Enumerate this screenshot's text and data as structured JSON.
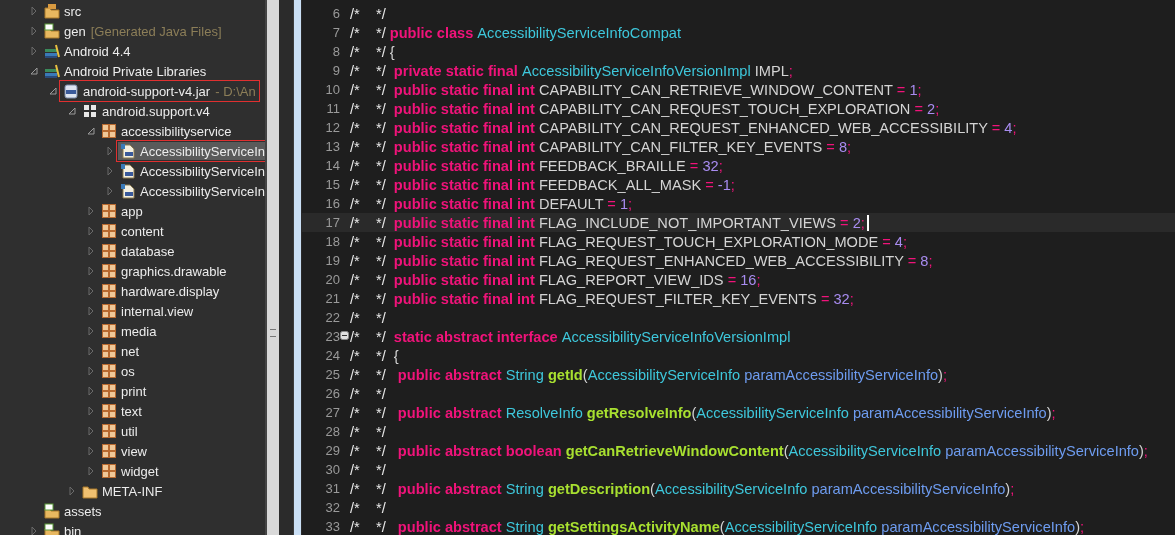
{
  "package_explorer": {
    "items": [
      {
        "label": "src",
        "kind": "source-folder",
        "expanded": false,
        "selected": false,
        "highlighted": false
      },
      {
        "label": "gen",
        "suffix": "[Generated Java Files]",
        "kind": "gen-folder",
        "expanded": false,
        "selected": false,
        "highlighted": false
      },
      {
        "label": "Android 4.4",
        "kind": "library",
        "expanded": false,
        "selected": false,
        "highlighted": false
      },
      {
        "label": "Android Private Libraries",
        "kind": "library",
        "expanded": true,
        "selected": false,
        "highlighted": false,
        "children": [
          {
            "label": "android-support-v4.jar",
            "suffix": "- D:\\An",
            "kind": "jar",
            "expanded": true,
            "selected": false,
            "highlighted": true,
            "children": [
              {
                "label": "android.support.v4",
                "kind": "package-root",
                "expanded": true,
                "selected": false,
                "highlighted": false,
                "children": [
                  {
                    "label": "accessibilityservice",
                    "kind": "package",
                    "expanded": true,
                    "selected": false,
                    "highlighted": false,
                    "children": [
                      {
                        "label": "AccessibilityServiceIn",
                        "kind": "class-file",
                        "expanded": false,
                        "selected": true,
                        "highlighted": true
                      },
                      {
                        "label": "AccessibilityServiceIn",
                        "kind": "class-file",
                        "expanded": false,
                        "selected": false,
                        "highlighted": false
                      },
                      {
                        "label": "AccessibilityServiceIn",
                        "kind": "class-file",
                        "expanded": false,
                        "selected": false,
                        "highlighted": false
                      }
                    ]
                  },
                  {
                    "label": "app",
                    "kind": "package",
                    "expanded": false,
                    "selected": false,
                    "highlighted": false
                  },
                  {
                    "label": "content",
                    "kind": "package",
                    "expanded": false,
                    "selected": false,
                    "highlighted": false
                  },
                  {
                    "label": "database",
                    "kind": "package",
                    "expanded": false,
                    "selected": false,
                    "highlighted": false
                  },
                  {
                    "label": "graphics.drawable",
                    "kind": "package",
                    "expanded": false,
                    "selected": false,
                    "highlighted": false
                  },
                  {
                    "label": "hardware.display",
                    "kind": "package",
                    "expanded": false,
                    "selected": false,
                    "highlighted": false
                  },
                  {
                    "label": "internal.view",
                    "kind": "package",
                    "expanded": false,
                    "selected": false,
                    "highlighted": false
                  },
                  {
                    "label": "media",
                    "kind": "package",
                    "expanded": false,
                    "selected": false,
                    "highlighted": false
                  },
                  {
                    "label": "net",
                    "kind": "package",
                    "expanded": false,
                    "selected": false,
                    "highlighted": false
                  },
                  {
                    "label": "os",
                    "kind": "package",
                    "expanded": false,
                    "selected": false,
                    "highlighted": false
                  },
                  {
                    "label": "print",
                    "kind": "package",
                    "expanded": false,
                    "selected": false,
                    "highlighted": false
                  },
                  {
                    "label": "text",
                    "kind": "package",
                    "expanded": false,
                    "selected": false,
                    "highlighted": false
                  },
                  {
                    "label": "util",
                    "kind": "package",
                    "expanded": false,
                    "selected": false,
                    "highlighted": false
                  },
                  {
                    "label": "view",
                    "kind": "package",
                    "expanded": false,
                    "selected": false,
                    "highlighted": false
                  },
                  {
                    "label": "widget",
                    "kind": "package",
                    "expanded": false,
                    "selected": false,
                    "highlighted": false
                  }
                ]
              },
              {
                "label": "META-INF",
                "kind": "folder",
                "expanded": false,
                "selected": false,
                "highlighted": false
              }
            ]
          }
        ]
      },
      {
        "label": "assets",
        "kind": "gen-folder",
        "selected": false,
        "highlighted": false
      },
      {
        "label": "bin",
        "kind": "gen-folder",
        "expanded": false,
        "selected": false,
        "highlighted": false
      }
    ]
  },
  "editor": {
    "lines": [
      {
        "number": "6",
        "current": false,
        "tokens": [
          {
            "kind": "comment",
            "text": "/*    */"
          }
        ]
      },
      {
        "number": "7",
        "current": false,
        "tokens": [
          {
            "kind": "comment",
            "text": "/*    */ "
          },
          {
            "kind": "keyword",
            "text": "public class "
          },
          {
            "kind": "type",
            "text": "AccessibilityServiceInfoCompat"
          }
        ]
      },
      {
        "number": "8",
        "current": false,
        "tokens": [
          {
            "kind": "comment",
            "text": "/*    */ "
          },
          {
            "kind": "plain",
            "text": "{"
          }
        ]
      },
      {
        "number": "9",
        "current": false,
        "tokens": [
          {
            "kind": "comment",
            "text": "/*    */  "
          },
          {
            "kind": "keyword",
            "text": "private static final "
          },
          {
            "kind": "type",
            "text": "AccessibilityServiceInfoVersionImpl "
          },
          {
            "kind": "plain",
            "text": "IMPL"
          },
          {
            "kind": "operator",
            "text": ";"
          }
        ]
      },
      {
        "number": "10",
        "current": false,
        "tokens": [
          {
            "kind": "comment",
            "text": "/*    */  "
          },
          {
            "kind": "keyword",
            "text": "public static final int "
          },
          {
            "kind": "plain",
            "text": "CAPABILITY_CAN_RETRIEVE_WINDOW_CONTENT "
          },
          {
            "kind": "operator",
            "text": "= "
          },
          {
            "kind": "number",
            "text": "1"
          },
          {
            "kind": "operator",
            "text": ";"
          }
        ]
      },
      {
        "number": "11",
        "current": false,
        "tokens": [
          {
            "kind": "comment",
            "text": "/*    */  "
          },
          {
            "kind": "keyword",
            "text": "public static final int "
          },
          {
            "kind": "plain",
            "text": "CAPABILITY_CAN_REQUEST_TOUCH_EXPLORATION "
          },
          {
            "kind": "operator",
            "text": "= "
          },
          {
            "kind": "number",
            "text": "2"
          },
          {
            "kind": "operator",
            "text": ";"
          }
        ]
      },
      {
        "number": "12",
        "current": false,
        "tokens": [
          {
            "kind": "comment",
            "text": "/*    */  "
          },
          {
            "kind": "keyword",
            "text": "public static final int "
          },
          {
            "kind": "plain",
            "text": "CAPABILITY_CAN_REQUEST_ENHANCED_WEB_ACCESSIBILITY "
          },
          {
            "kind": "operator",
            "text": "= "
          },
          {
            "kind": "number",
            "text": "4"
          },
          {
            "kind": "operator",
            "text": ";"
          }
        ]
      },
      {
        "number": "13",
        "current": false,
        "tokens": [
          {
            "kind": "comment",
            "text": "/*    */  "
          },
          {
            "kind": "keyword",
            "text": "public static final int "
          },
          {
            "kind": "plain",
            "text": "CAPABILITY_CAN_FILTER_KEY_EVENTS "
          },
          {
            "kind": "operator",
            "text": "= "
          },
          {
            "kind": "number",
            "text": "8"
          },
          {
            "kind": "operator",
            "text": ";"
          }
        ]
      },
      {
        "number": "14",
        "current": false,
        "tokens": [
          {
            "kind": "comment",
            "text": "/*    */  "
          },
          {
            "kind": "keyword",
            "text": "public static final int "
          },
          {
            "kind": "plain",
            "text": "FEEDBACK_BRAILLE "
          },
          {
            "kind": "operator",
            "text": "= "
          },
          {
            "kind": "number",
            "text": "32"
          },
          {
            "kind": "operator",
            "text": ";"
          }
        ]
      },
      {
        "number": "15",
        "current": false,
        "tokens": [
          {
            "kind": "comment",
            "text": "/*    */  "
          },
          {
            "kind": "keyword",
            "text": "public static final int "
          },
          {
            "kind": "plain",
            "text": "FEEDBACK_ALL_MASK "
          },
          {
            "kind": "operator",
            "text": "= "
          },
          {
            "kind": "number",
            "text": "-1"
          },
          {
            "kind": "operator",
            "text": ";"
          }
        ]
      },
      {
        "number": "16",
        "current": false,
        "tokens": [
          {
            "kind": "comment",
            "text": "/*    */  "
          },
          {
            "kind": "keyword",
            "text": "public static final int "
          },
          {
            "kind": "plain",
            "text": "DEFAULT "
          },
          {
            "kind": "operator",
            "text": "= "
          },
          {
            "kind": "number",
            "text": "1"
          },
          {
            "kind": "operator",
            "text": ";"
          }
        ]
      },
      {
        "number": "17",
        "current": true,
        "tokens": [
          {
            "kind": "comment",
            "text": "/*    */  "
          },
          {
            "kind": "keyword",
            "text": "public static final int "
          },
          {
            "kind": "plain",
            "text": "FLAG_INCLUDE_NOT_IMPORTANT_VIEWS "
          },
          {
            "kind": "operator",
            "text": "= "
          },
          {
            "kind": "number",
            "text": "2"
          },
          {
            "kind": "operator",
            "text": ";"
          }
        ]
      },
      {
        "number": "18",
        "current": false,
        "tokens": [
          {
            "kind": "comment",
            "text": "/*    */  "
          },
          {
            "kind": "keyword",
            "text": "public static final int "
          },
          {
            "kind": "plain",
            "text": "FLAG_REQUEST_TOUCH_EXPLORATION_MODE "
          },
          {
            "kind": "operator",
            "text": "= "
          },
          {
            "kind": "number",
            "text": "4"
          },
          {
            "kind": "operator",
            "text": ";"
          }
        ]
      },
      {
        "number": "19",
        "current": false,
        "tokens": [
          {
            "kind": "comment",
            "text": "/*    */  "
          },
          {
            "kind": "keyword",
            "text": "public static final int "
          },
          {
            "kind": "plain",
            "text": "FLAG_REQUEST_ENHANCED_WEB_ACCESSIBILITY "
          },
          {
            "kind": "operator",
            "text": "= "
          },
          {
            "kind": "number",
            "text": "8"
          },
          {
            "kind": "operator",
            "text": ";"
          }
        ]
      },
      {
        "number": "20",
        "current": false,
        "tokens": [
          {
            "kind": "comment",
            "text": "/*    */  "
          },
          {
            "kind": "keyword",
            "text": "public static final int "
          },
          {
            "kind": "plain",
            "text": "FLAG_REPORT_VIEW_IDS "
          },
          {
            "kind": "operator",
            "text": "= "
          },
          {
            "kind": "number",
            "text": "16"
          },
          {
            "kind": "operator",
            "text": ";"
          }
        ]
      },
      {
        "number": "21",
        "current": false,
        "tokens": [
          {
            "kind": "comment",
            "text": "/*    */  "
          },
          {
            "kind": "keyword",
            "text": "public static final int "
          },
          {
            "kind": "plain",
            "text": "FLAG_REQUEST_FILTER_KEY_EVENTS "
          },
          {
            "kind": "operator",
            "text": "= "
          },
          {
            "kind": "number",
            "text": "32"
          },
          {
            "kind": "operator",
            "text": ";"
          }
        ]
      },
      {
        "number": "22",
        "current": false,
        "tokens": [
          {
            "kind": "comment",
            "text": "/*    */"
          }
        ]
      },
      {
        "number": "23",
        "current": false,
        "folded": false,
        "tokens": [
          {
            "kind": "comment",
            "text": "/*    */  "
          },
          {
            "kind": "keyword",
            "text": "static abstract interface "
          },
          {
            "kind": "type",
            "text": "AccessibilityServiceInfoVersionImpl"
          }
        ]
      },
      {
        "number": "24",
        "current": false,
        "tokens": [
          {
            "kind": "comment",
            "text": "/*    */  "
          },
          {
            "kind": "plain",
            "text": "{"
          }
        ]
      },
      {
        "number": "25",
        "current": false,
        "tokens": [
          {
            "kind": "comment",
            "text": "/*    */   "
          },
          {
            "kind": "keyword",
            "text": "public abstract "
          },
          {
            "kind": "type",
            "text": "String "
          },
          {
            "kind": "method",
            "text": "getId"
          },
          {
            "kind": "plain",
            "text": "("
          },
          {
            "kind": "type",
            "text": "AccessibilityServiceInfo "
          },
          {
            "kind": "param",
            "text": "paramAccessibilityServiceInfo"
          },
          {
            "kind": "plain",
            "text": ")"
          },
          {
            "kind": "operator",
            "text": ";"
          }
        ]
      },
      {
        "number": "26",
        "current": false,
        "tokens": [
          {
            "kind": "comment",
            "text": "/*    */"
          }
        ]
      },
      {
        "number": "27",
        "current": false,
        "tokens": [
          {
            "kind": "comment",
            "text": "/*    */   "
          },
          {
            "kind": "keyword",
            "text": "public abstract "
          },
          {
            "kind": "type",
            "text": "ResolveInfo "
          },
          {
            "kind": "method",
            "text": "getResolveInfo"
          },
          {
            "kind": "plain",
            "text": "("
          },
          {
            "kind": "type",
            "text": "AccessibilityServiceInfo "
          },
          {
            "kind": "param",
            "text": "paramAccessibilityServiceInfo"
          },
          {
            "kind": "plain",
            "text": ")"
          },
          {
            "kind": "operator",
            "text": ";"
          }
        ]
      },
      {
        "number": "28",
        "current": false,
        "tokens": [
          {
            "kind": "comment",
            "text": "/*    */"
          }
        ]
      },
      {
        "number": "29",
        "current": false,
        "tokens": [
          {
            "kind": "comment",
            "text": "/*    */   "
          },
          {
            "kind": "keyword",
            "text": "public abstract boolean "
          },
          {
            "kind": "method",
            "text": "getCanRetrieveWindowContent"
          },
          {
            "kind": "plain",
            "text": "("
          },
          {
            "kind": "type",
            "text": "AccessibilityServiceInfo "
          },
          {
            "kind": "param",
            "text": "paramAccessibilityServiceInfo"
          },
          {
            "kind": "plain",
            "text": ")"
          },
          {
            "kind": "operator",
            "text": ";"
          }
        ]
      },
      {
        "number": "30",
        "current": false,
        "tokens": [
          {
            "kind": "comment",
            "text": "/*    */"
          }
        ]
      },
      {
        "number": "31",
        "current": false,
        "tokens": [
          {
            "kind": "comment",
            "text": "/*    */   "
          },
          {
            "kind": "keyword",
            "text": "public abstract "
          },
          {
            "kind": "type",
            "text": "String "
          },
          {
            "kind": "method",
            "text": "getDescription"
          },
          {
            "kind": "plain",
            "text": "("
          },
          {
            "kind": "type",
            "text": "AccessibilityServiceInfo "
          },
          {
            "kind": "param",
            "text": "paramAccessibilityServiceInfo"
          },
          {
            "kind": "plain",
            "text": ")"
          },
          {
            "kind": "operator",
            "text": ";"
          }
        ]
      },
      {
        "number": "32",
        "current": false,
        "tokens": [
          {
            "kind": "comment",
            "text": "/*    */"
          }
        ]
      },
      {
        "number": "33",
        "current": false,
        "tokens": [
          {
            "kind": "comment",
            "text": "/*    */   "
          },
          {
            "kind": "keyword",
            "text": "public abstract "
          },
          {
            "kind": "type",
            "text": "String "
          },
          {
            "kind": "method",
            "text": "getSettingsActivityName"
          },
          {
            "kind": "plain",
            "text": "("
          },
          {
            "kind": "type",
            "text": "AccessibilityServiceInfo "
          },
          {
            "kind": "param",
            "text": "paramAccessibilityServiceInfo"
          },
          {
            "kind": "plain",
            "text": ")"
          },
          {
            "kind": "operator",
            "text": ";"
          }
        ]
      }
    ]
  }
}
